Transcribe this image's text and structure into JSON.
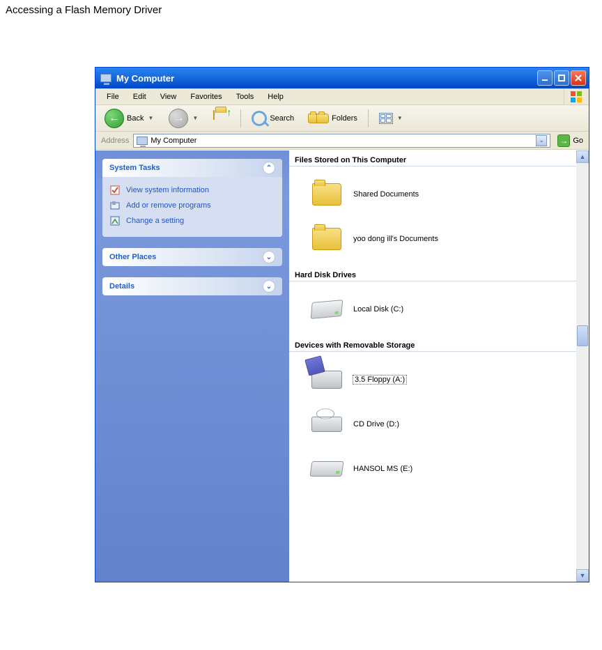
{
  "page_title": "Accessing a Flash Memory Driver",
  "window": {
    "title": "My Computer",
    "menus": [
      "File",
      "Edit",
      "View",
      "Favorites",
      "Tools",
      "Help"
    ],
    "toolbar": {
      "back": "Back",
      "search": "Search",
      "folders": "Folders"
    },
    "address": {
      "label": "Address",
      "value": "My Computer",
      "go": "Go"
    }
  },
  "side": {
    "panels": [
      {
        "title": "System Tasks",
        "collapsed": false,
        "tasks": [
          "View system information",
          "Add or remove programs",
          "Change a setting"
        ]
      },
      {
        "title": "Other Places",
        "collapsed": true,
        "tasks": []
      },
      {
        "title": "Details",
        "collapsed": true,
        "tasks": []
      }
    ]
  },
  "groups": [
    {
      "title": "Files Stored on This Computer",
      "items": [
        {
          "icon": "folder",
          "label": "Shared Documents",
          "selected": false
        },
        {
          "icon": "folder",
          "label": "yoo dong ill's Documents",
          "selected": false
        }
      ]
    },
    {
      "title": "Hard Disk Drives",
      "items": [
        {
          "icon": "hdd",
          "label": "Local Disk (C:)",
          "selected": false
        }
      ]
    },
    {
      "title": "Devices with Removable Storage",
      "items": [
        {
          "icon": "floppy",
          "label": "3.5 Floppy (A:)",
          "selected": true
        },
        {
          "icon": "cd",
          "label": "CD Drive (D:)",
          "selected": false
        },
        {
          "icon": "ext",
          "label": "HANSOL MS (E:)",
          "selected": false
        }
      ]
    }
  ]
}
